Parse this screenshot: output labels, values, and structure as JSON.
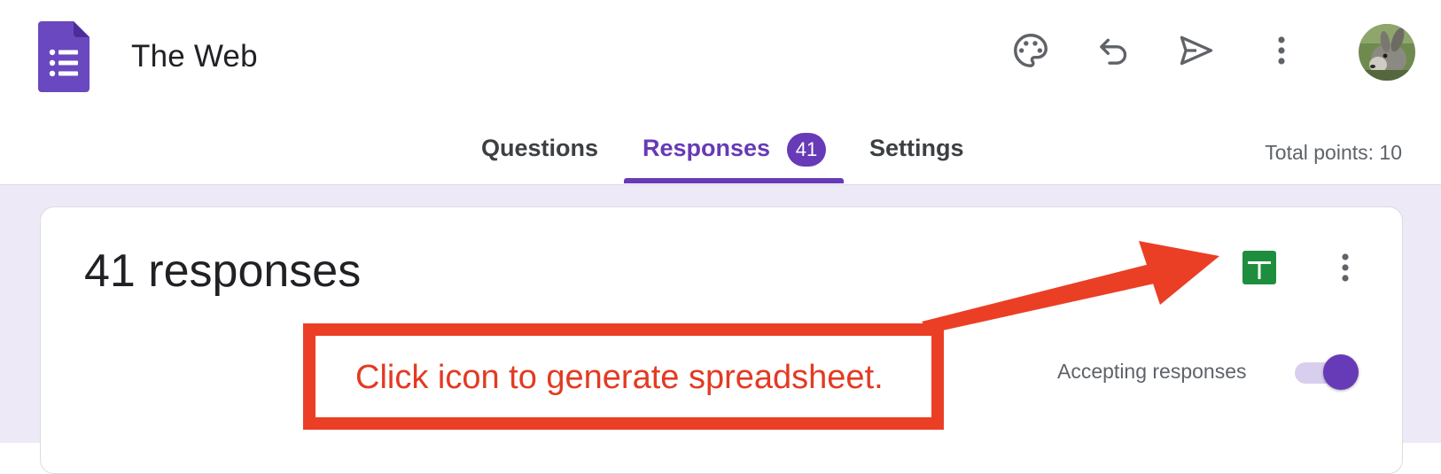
{
  "app": {
    "logo_icon": "google-forms-logo-icon",
    "doc_title": "The Web"
  },
  "toolbar": {
    "icons": [
      "palette-icon",
      "undo-icon",
      "send-icon",
      "more-vert-icon"
    ],
    "avatar": "user-avatar"
  },
  "tabs": [
    {
      "label": "Questions",
      "active": false
    },
    {
      "label": "Responses",
      "active": true,
      "badge": "41"
    },
    {
      "label": "Settings",
      "active": false
    }
  ],
  "total_points": "Total points: 10",
  "responses_panel": {
    "count_label": "41 responses",
    "sheets_icon": "google-sheets-icon",
    "more_icon": "more-vert-icon",
    "accepting_label": "Accepting responses",
    "accepting_on": true
  },
  "annotation": {
    "text": "Click icon to generate spreadsheet.",
    "color": "#ea3f25"
  },
  "colors": {
    "accent": "#673ab7",
    "background": "#eee9f6",
    "sheets_green": "#1e8e3e"
  }
}
